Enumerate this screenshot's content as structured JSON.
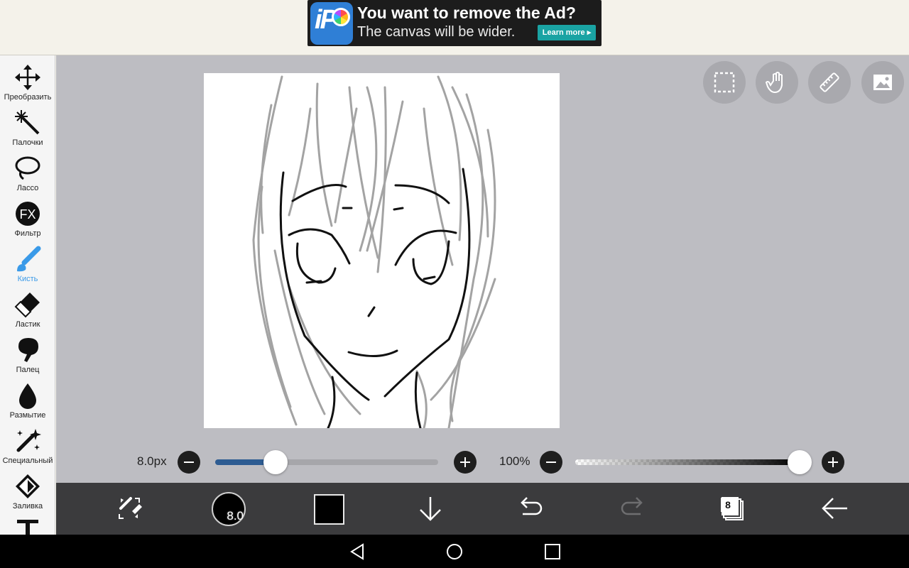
{
  "ad": {
    "title": "You want to remove the Ad?",
    "subtitle": "The canvas will be wider.",
    "button": "Learn more ▸",
    "logo_icon": "ibispaint-logo-icon"
  },
  "tools": [
    {
      "label": "Преобразить",
      "icon": "move-arrows-icon",
      "active": false
    },
    {
      "label": "Палочки",
      "icon": "magic-wand-icon",
      "active": false
    },
    {
      "label": "Лассо",
      "icon": "lasso-icon",
      "active": false
    },
    {
      "label": "Фильтр",
      "icon": "fx-icon",
      "active": false
    },
    {
      "label": "Кисть",
      "icon": "brush-icon",
      "active": true
    },
    {
      "label": "Ластик",
      "icon": "eraser-icon",
      "active": false
    },
    {
      "label": "Палец",
      "icon": "finger-icon",
      "active": false
    },
    {
      "label": "Размытие",
      "icon": "blur-drop-icon",
      "active": false
    },
    {
      "label": "Специальный",
      "icon": "special-pen-icon",
      "active": false
    },
    {
      "label": "Заливка",
      "icon": "fill-bucket-icon",
      "active": false
    },
    {
      "label": "",
      "icon": "text-icon",
      "active": false
    }
  ],
  "canvas_tools": [
    "selection-icon",
    "hand-icon",
    "ruler-icon",
    "reference-image-icon"
  ],
  "brush_size": {
    "label": "8.0px",
    "value": 8.0,
    "fraction": 0.27
  },
  "opacity": {
    "label": "100%",
    "fraction": 1.0
  },
  "bottom": {
    "brush_preview_label": "8.0",
    "current_color": "#000000",
    "layers_count": "8",
    "icons": [
      "swap-tool-icon",
      "brush-preview-icon",
      "color-swatch-icon",
      "download-icon",
      "undo-icon",
      "redo-icon",
      "layers-icon",
      "back-arrow-icon"
    ]
  },
  "colors": {
    "accent": "#3a9ae8",
    "workspace": "#bdbdc2",
    "bottombar": "#3b3b3d",
    "slider_fill": "#2e5c92"
  }
}
